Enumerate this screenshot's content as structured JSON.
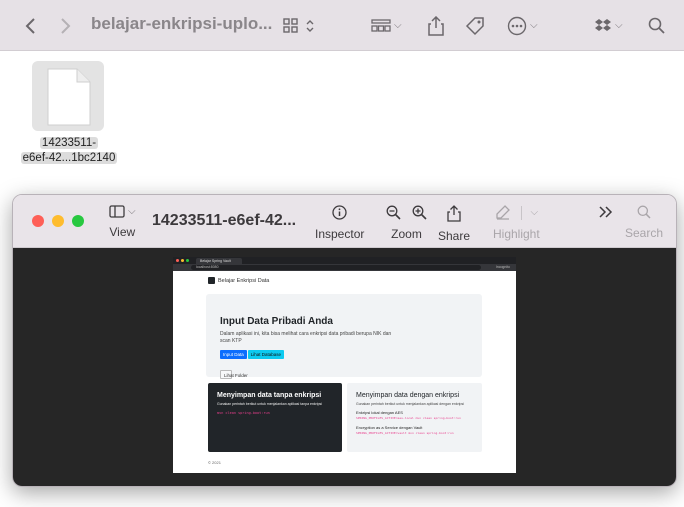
{
  "finder": {
    "title": "belajar-enkripsi-uplo...",
    "icons": [
      "chevron-left-icon",
      "chevron-right-icon",
      "grid-view-icon",
      "group-by-icon",
      "share-icon",
      "tag-icon",
      "more-icon",
      "dropbox-icon",
      "search-icon"
    ]
  },
  "file": {
    "name_line1": "14233511-",
    "name_line2": "e6ef-42...1bc2140"
  },
  "preview": {
    "title": "14233511-e6ef-42...",
    "tools": {
      "view": "View",
      "inspector": "Inspector",
      "zoom": "Zoom",
      "share": "Share",
      "highlight": "Highlight",
      "search": "Search"
    }
  },
  "browser": {
    "tab_title": "Belajar Spring Vault",
    "url": "localhost:8080",
    "profile": "Incognito"
  },
  "site": {
    "brand": "Belajar Enkripsi Data",
    "hero": {
      "title": "Input Data Pribadi Anda",
      "description": "Dalam aplikasi ini, kita bisa melihat cara enkripsi data pribadi berupa NIK dan scan KTP",
      "buttons": {
        "input": "Input Data",
        "db": "Lihat Database",
        "folder": "Lihat Folder"
      }
    },
    "card_plain": {
      "title": "Menyimpan data tanpa enkripsi",
      "subtitle": "Gunakan perintah berikut untuk menjalankan aplikasi tanpa enkripsi",
      "code": "mvn clean spring-boot:run"
    },
    "card_enc": {
      "title": "Menyimpan data dengan enkripsi",
      "subtitle": "Gunakan perintah berikut untuk menjalankan aplikasi dengan enkripsi",
      "aes_heading": "Enkripsi lokal dengan AES",
      "aes_code": "SPRING_PROFILES_ACTIVE=aes-local mvn clean spring-boot:run",
      "vault_heading": "Encryption as a Service dengan Vault",
      "vault_code": "SPRING_PROFILES_ACTIVE=vault mvn clean spring-boot:run"
    },
    "footer": "© 2021"
  },
  "colors": {
    "finder_bar": "#e6e1e6",
    "preview_bg": "#262626",
    "primary": "#0d6efd",
    "info": "#0dcaf0",
    "dark_card": "#212529",
    "code_pink": "#e83e8c",
    "traffic_red": "#fe5f57",
    "traffic_yellow": "#febc2e",
    "traffic_green": "#28c840"
  }
}
